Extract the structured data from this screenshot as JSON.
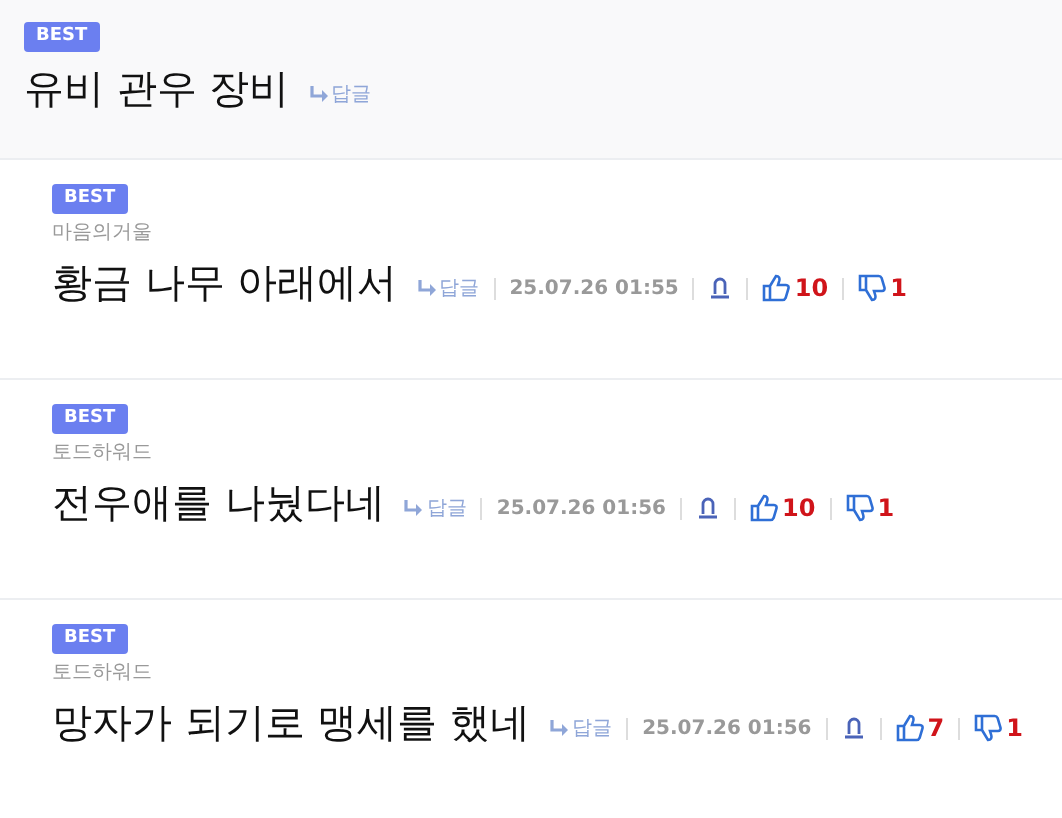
{
  "post": {
    "badge": "BEST",
    "title": "유비 관우 장비",
    "reply_label": "답글"
  },
  "comments": [
    {
      "badge": "BEST",
      "author": "마음의거울",
      "text": "황금 나무 아래에서",
      "reply_label": "답글",
      "date": "25.07.26 01:55",
      "likes": "10",
      "dislikes": "1"
    },
    {
      "badge": "BEST",
      "author": "토드하워드",
      "text": "전우애를 나눴다네",
      "reply_label": "답글",
      "date": "25.07.26 01:56",
      "likes": "10",
      "dislikes": "1"
    },
    {
      "badge": "BEST",
      "author": "토드하워드",
      "text": "망자가 되기로 맹세를 했네",
      "reply_label": "답글",
      "date": "25.07.26 01:56",
      "likes": "7",
      "dislikes": "1"
    }
  ]
}
